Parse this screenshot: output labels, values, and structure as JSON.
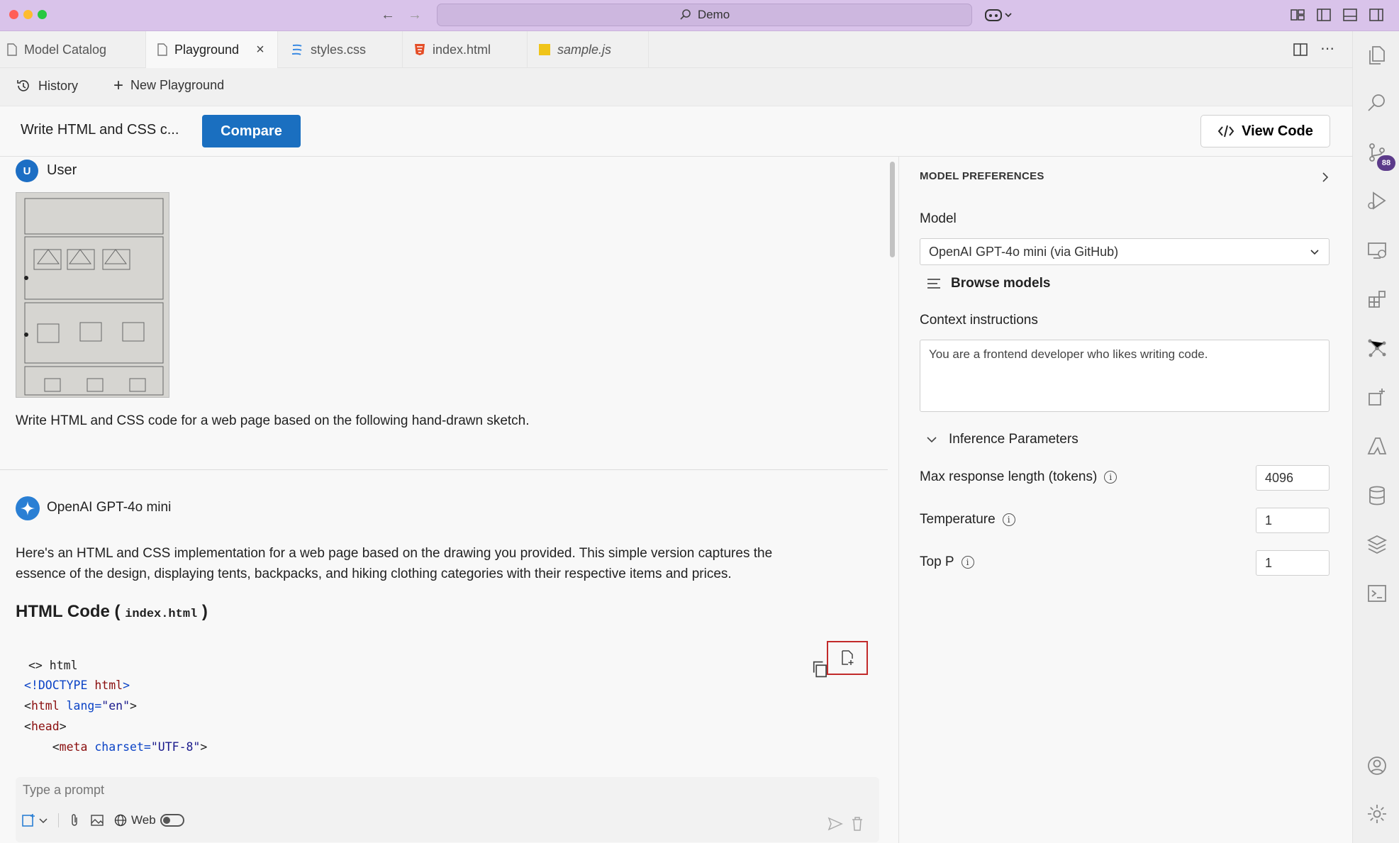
{
  "titlebar": {
    "search_text": "Demo"
  },
  "tabs": [
    {
      "label": "Model Catalog",
      "icon": "file-icon"
    },
    {
      "label": "Playground",
      "icon": "file-icon",
      "active": true
    },
    {
      "label": "styles.css",
      "icon": "css-icon"
    },
    {
      "label": "index.html",
      "icon": "html-icon"
    },
    {
      "label": "sample.js",
      "icon": "js-icon"
    }
  ],
  "toolbar": {
    "history": "History",
    "new_playground": "New Playground"
  },
  "header": {
    "title": "Write HTML and CSS c...",
    "compare": "Compare",
    "view_code": "View Code"
  },
  "chat": {
    "user_name": "User",
    "user_initial": "U",
    "user_message": "Write HTML and CSS code for a web page based on the following hand-drawn sketch.",
    "bot_name": "OpenAI GPT-4o mini",
    "bot_message_1": "Here's an HTML and CSS implementation for a web page based on the drawing you provided. This simple version captures the",
    "bot_message_2": "essence of the design, displaying tents, backpacks, and hiking clothing categories with their respective items and prices.",
    "heading_prefix": "HTML Code (",
    "heading_code": "index.html",
    "heading_suffix": ")",
    "code_lang": "<> html",
    "code_lines": [
      {
        "a": "<!DOCTYPE ",
        "b": "html",
        "c": ">"
      },
      {
        "a": "<",
        "b": "html",
        "c": " lang=",
        "d": "\"en\"",
        "e": ">"
      },
      {
        "a": "<",
        "b": "head",
        "c": ">"
      },
      {
        "a": "    <",
        "b": "meta",
        "c": " charset=",
        "d": "\"UTF-8\"",
        "e": ">"
      }
    ],
    "prompt_placeholder": "Type a prompt",
    "web_label": "Web"
  },
  "prefs": {
    "heading": "MODEL PREFERENCES",
    "model_label": "Model",
    "model_value": "OpenAI GPT-4o mini (via GitHub)",
    "browse_models": "Browse models",
    "context_label": "Context instructions",
    "context_value": "You are a frontend developer who likes writing code.",
    "inference_label": "Inference Parameters",
    "max_tokens_label": "Max response length (tokens)",
    "max_tokens_value": "4096",
    "temperature_label": "Temperature",
    "temperature_value": "1",
    "top_p_label": "Top P",
    "top_p_value": "1"
  },
  "activitybar": {
    "badge_count": "88"
  },
  "colors": {
    "accent": "#1a6fc0",
    "titlebar": "#d9c3ea",
    "highlight_box": "#c22a2a"
  }
}
